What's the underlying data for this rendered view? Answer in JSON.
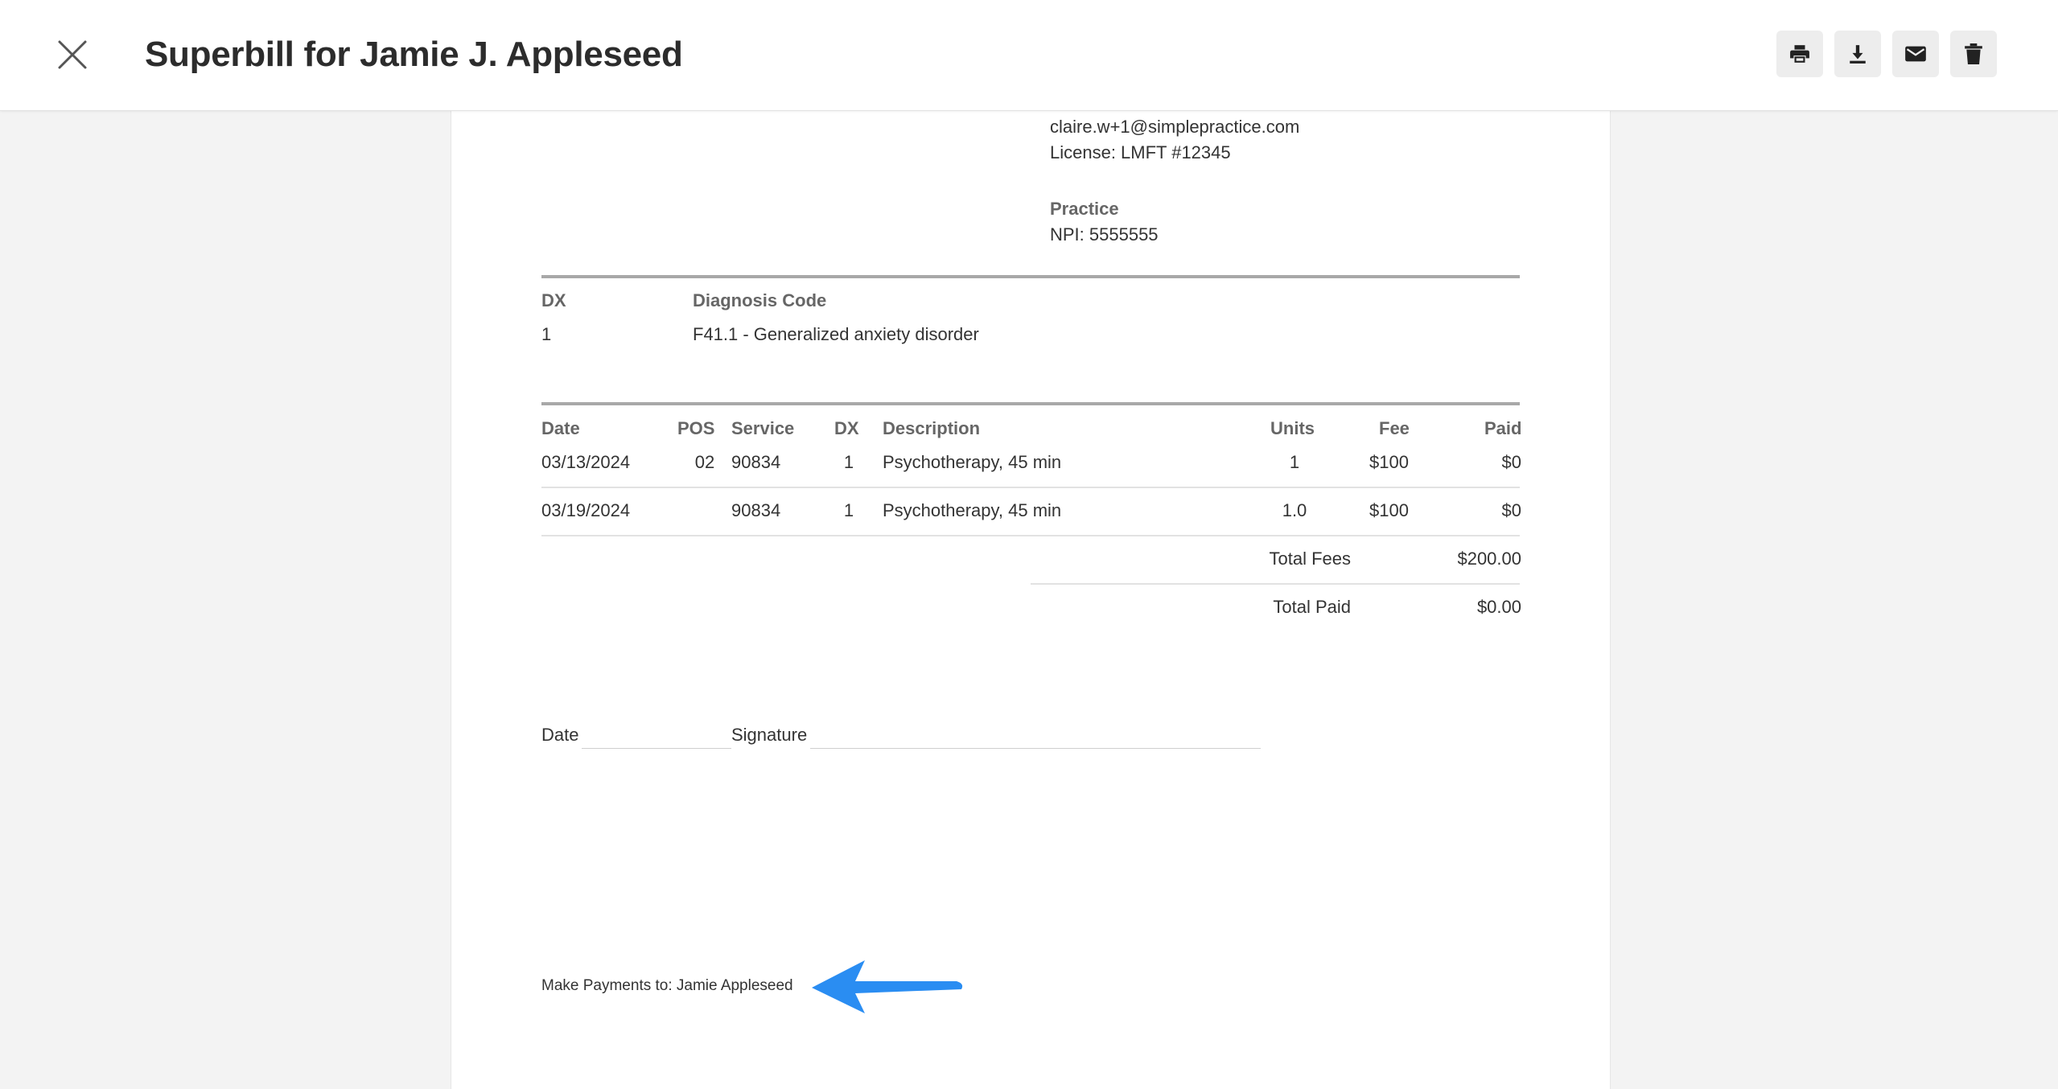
{
  "header": {
    "title": "Superbill for Jamie J. Appleseed",
    "close_icon": "close-icon",
    "actions": [
      {
        "name": "print-button",
        "icon": "printer-icon"
      },
      {
        "name": "download-button",
        "icon": "download-icon"
      },
      {
        "name": "email-button",
        "icon": "envelope-icon"
      },
      {
        "name": "delete-button",
        "icon": "trash-icon"
      }
    ]
  },
  "provider": {
    "email": "claire.w+1@simplepractice.com",
    "license": "License: LMFT #12345",
    "practice_label": "Practice",
    "npi": "NPI: 5555555"
  },
  "diagnosis": {
    "headers": {
      "dx": "DX",
      "code": "Diagnosis Code"
    },
    "rows": [
      {
        "dx": "1",
        "code": "F41.1 - Generalized anxiety disorder"
      }
    ]
  },
  "services": {
    "headers": {
      "date": "Date",
      "pos": "POS",
      "service": "Service",
      "dx": "DX",
      "description": "Description",
      "units": "Units",
      "fee": "Fee",
      "paid": "Paid"
    },
    "rows": [
      {
        "date": "03/13/2024",
        "pos": "02",
        "service": "90834",
        "dx": "1",
        "description": "Psychotherapy, 45 min",
        "units": "1",
        "fee": "$100",
        "paid": "$0"
      },
      {
        "date": "03/19/2024",
        "pos": "",
        "service": "90834",
        "dx": "1",
        "description": "Psychotherapy, 45 min",
        "units": "1.0",
        "fee": "$100",
        "paid": "$0"
      }
    ]
  },
  "totals": {
    "fees_label": "Total Fees",
    "fees_value": "$200.00",
    "paid_label": "Total Paid",
    "paid_value": "$0.00"
  },
  "signature": {
    "date_label": "Date",
    "signature_label": "Signature"
  },
  "footer": {
    "payments": "Make Payments to: Jamie Appleseed"
  },
  "annotation": {
    "arrow_color": "#2a8df2",
    "icon": "arrow-left-icon"
  }
}
